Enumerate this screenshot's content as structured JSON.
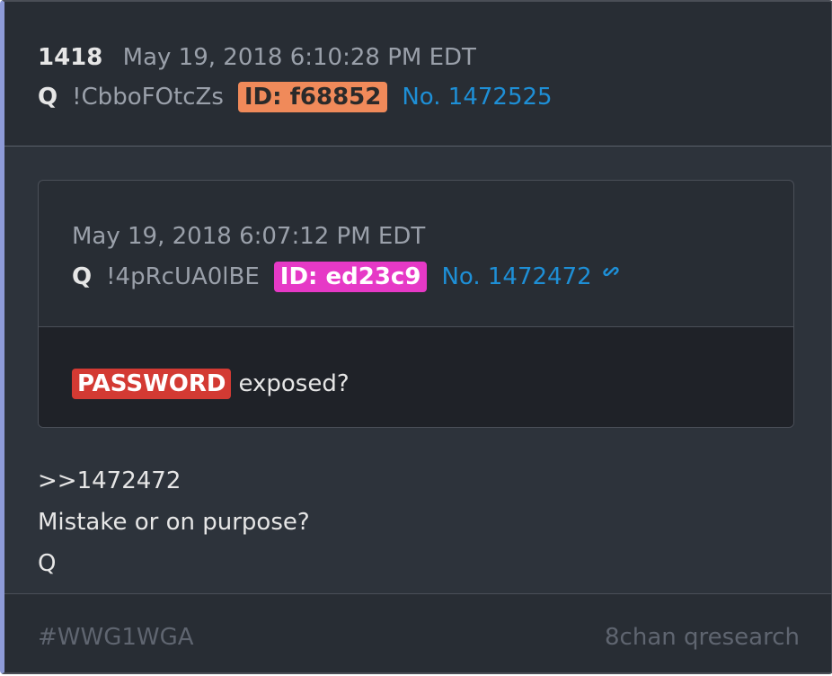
{
  "post": {
    "number": "1418",
    "date": "May 19, 2018 6:10:28 PM EDT",
    "author": "Q",
    "tripcode": "!CbboFOtcZs",
    "id_label": "ID: f68852",
    "post_no": "No. 1472525",
    "id_color": "#f08a5a"
  },
  "quoted_post": {
    "date": "May 19, 2018 6:07:12 PM EDT",
    "author": "Q",
    "tripcode": "!4pRcUA0lBE",
    "id_label": "ID: ed23c9",
    "post_no": "No. 1472472",
    "link_icon": "link-icon",
    "id_color": "#e639c6",
    "badge_text": "PASSWORD",
    "text": "exposed?"
  },
  "body": {
    "lines": [
      ">>1472472",
      "Mistake or on purpose?",
      "Q"
    ]
  },
  "footer": {
    "hashtag": "#WWG1WGA",
    "source": "8chan qresearch"
  }
}
